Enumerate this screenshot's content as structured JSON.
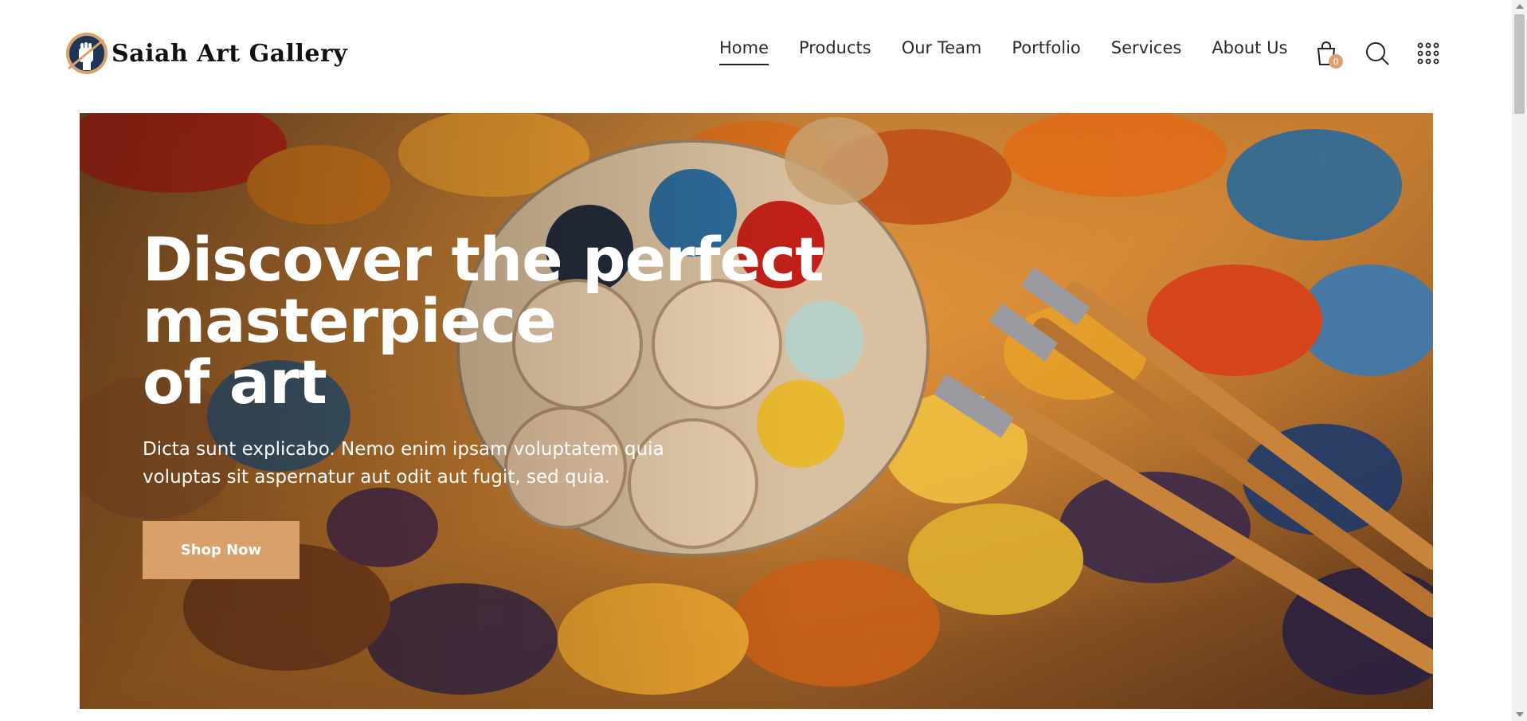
{
  "header": {
    "logo_text": "Saiah Art Gallery",
    "nav": [
      {
        "label": "Home",
        "active": true
      },
      {
        "label": "Products",
        "active": false
      },
      {
        "label": "Our Team",
        "active": false
      },
      {
        "label": "Portfolio",
        "active": false
      },
      {
        "label": "Services",
        "active": false
      },
      {
        "label": "About Us",
        "active": false
      }
    ],
    "cart_count": "0",
    "icons": [
      "shopping-bag-icon",
      "search-icon",
      "grid-menu-icon"
    ]
  },
  "hero": {
    "title_lines": [
      "Discover the perfect",
      "masterpiece",
      "of art"
    ],
    "description": "Dicta sunt explicabo. Nemo enim ipsam voluptatem quia voluptas sit aspernatur aut odit aut fugit, sed quia.",
    "button_label": "Shop Now"
  },
  "colors": {
    "accent": "#d9a06b",
    "text_dark": "#2a2a2a",
    "white": "#ffffff"
  }
}
